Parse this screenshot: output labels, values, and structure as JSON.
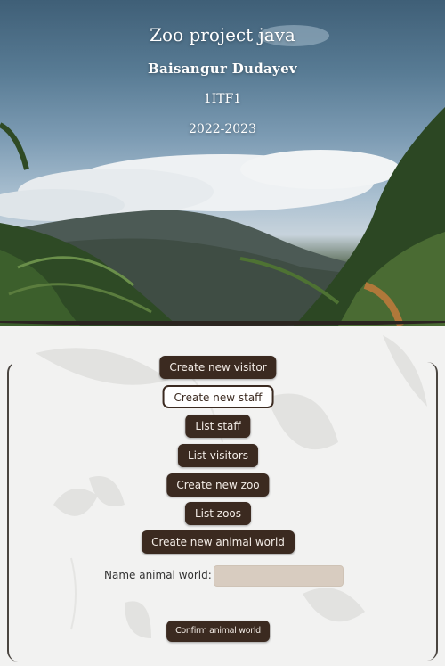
{
  "header": {
    "title": "Zoo project java",
    "author": "Baisangur Dudayev",
    "class": "1ITF1",
    "year": "2022-2023"
  },
  "actions": {
    "create_visitor": "Create new visitor",
    "create_staff": "Create new staff",
    "list_staff": "List staff",
    "list_visitors": "List visitors",
    "create_zoo": "Create new zoo",
    "list_zoos": "List zoos",
    "create_animal_world": "Create new animal world"
  },
  "animal_world_form": {
    "label": "Name animal world:",
    "value": "",
    "confirm_label": "Confirm animal world"
  },
  "colors": {
    "button_bg": "#3b2a20",
    "button_text": "#f3ece6",
    "panel_bg": "#f2f2f1",
    "input_bg": "#d8ccc0"
  }
}
